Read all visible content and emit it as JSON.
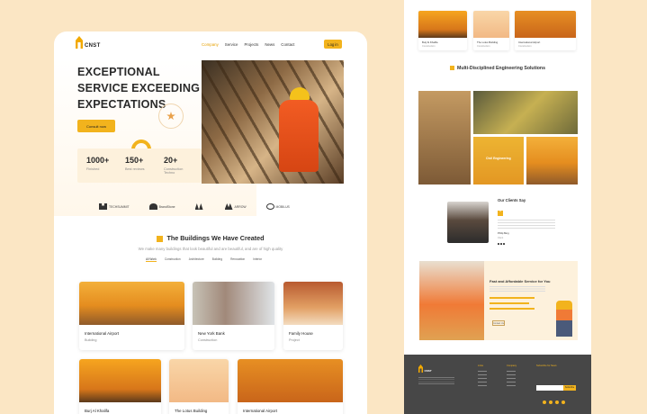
{
  "colors": {
    "accent": "#f2b31d",
    "background": "#fbe6c4",
    "footer": "#474747"
  },
  "nav": {
    "brand": "CNST",
    "items": [
      "Company",
      "Service",
      "Projects",
      "News",
      "Contact"
    ],
    "active_index": 0,
    "login": "Log in"
  },
  "hero": {
    "headline": [
      "EXCEPTIONAL",
      "SERVICE EXCEEDING",
      "EXPECTATIONS"
    ],
    "cta": "Consult now",
    "stats": [
      {
        "value": "1000+",
        "label": "Finished"
      },
      {
        "value": "150+",
        "label": "Best reviews"
      },
      {
        "value": "20+",
        "label": "Construction Techno"
      }
    ]
  },
  "partners": [
    "TECHSUMMIT",
    "BrandStone",
    "",
    "ARROW",
    "MOBILUS"
  ],
  "buildings": {
    "title": "The Buildings We Have Created",
    "subtitle": "We make many buildings that look beautiful and are beautiful, and are of high quality",
    "filters": [
      "All Work",
      "Construction",
      "Architecture",
      "Building",
      "Renovation",
      "Interior"
    ],
    "active_filter": 0,
    "cards": [
      {
        "title": "International Airport",
        "category": "Building"
      },
      {
        "title": "New York Bank",
        "category": "Construction"
      },
      {
        "title": "Family House",
        "category": "Project"
      },
      {
        "title": "Burj Al Khalifa",
        "category": ""
      },
      {
        "title": "The Lotus Building",
        "category": ""
      },
      {
        "title": "International Airport",
        "category": ""
      }
    ]
  },
  "right_page": {
    "top_cards": [
      {
        "title": "Burj Al Khalifa",
        "category": "Construction"
      },
      {
        "title": "The Lotus Building",
        "category": "Construction"
      },
      {
        "title": "International Airport",
        "category": "Construction"
      }
    ],
    "engineering": {
      "title": "Multi-Disciplined Engineering Solutions",
      "subtitle": "",
      "overlay": "Civil Engineering"
    },
    "testimonial": {
      "title": "Our Clients Say",
      "quote_mark": "“",
      "name": "Philip Berg",
      "role": "Client"
    },
    "cta": {
      "title": "Fast and Affordable Service for You",
      "button": "Contact Us"
    },
    "footer": {
      "brand": "CNST",
      "columns": [
        "Links",
        "Company",
        "Subscribe for News"
      ],
      "subscribe_button": "Subscribe"
    }
  }
}
